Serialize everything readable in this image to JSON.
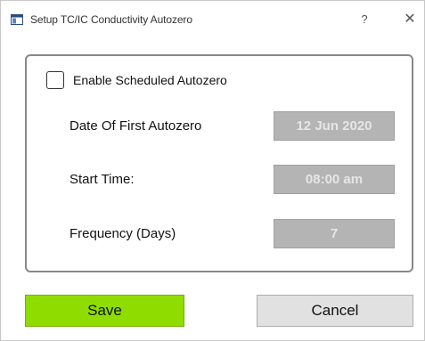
{
  "window": {
    "title": "Setup TC/IC Conductivity Autozero",
    "help_glyph": "?",
    "close_glyph": "✕"
  },
  "options": {
    "enable_scheduled_label": "Enable Scheduled Autozero",
    "enable_scheduled_checked": false
  },
  "fields": [
    {
      "label": "Date Of First Autozero",
      "value": "12 Jun 2020"
    },
    {
      "label": "Start Time:",
      "value": "08:00 am"
    },
    {
      "label": "Frequency (Days)",
      "value": "7"
    }
  ],
  "buttons": {
    "save_label": "Save",
    "cancel_label": "Cancel"
  },
  "colors": {
    "save_bg": "#8fdd00",
    "disabled_field_bg": "#b4b4b4",
    "cancel_bg": "#e1e1e1"
  }
}
